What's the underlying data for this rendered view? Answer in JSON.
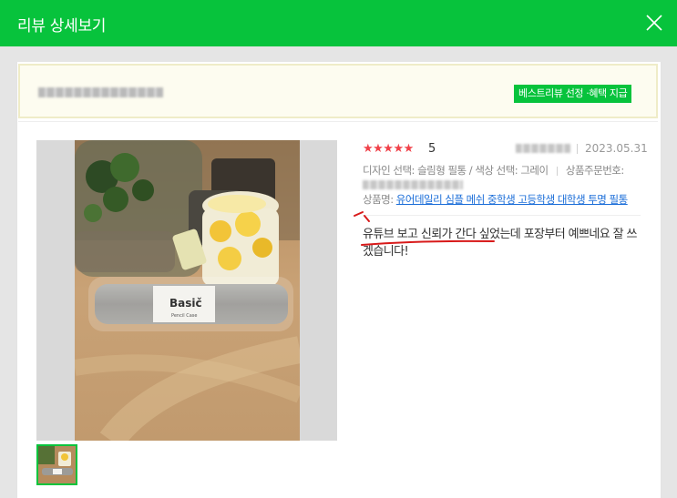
{
  "header": {
    "title": "리뷰 상세보기",
    "close_icon": "close-icon"
  },
  "banner": {
    "badge": "베스트리뷰 선정 ·혜택 지급"
  },
  "review": {
    "rating": 5,
    "stars": "★★★★★",
    "score_text": "5",
    "date": "2023.05.31",
    "options_line1": "디자인 선택: 슬림형 필통 / 색상 선택: 그레이",
    "order_label": "상품주문번호:",
    "product_label": "상품명:",
    "product_link": "유어데일리 심플 메쉬 중학생 고등학생 대학생 투명 필통",
    "body": "유튜브 보고 신뢰가 간다 싶었는데 포장부터 예쁘네요 잘 쓰겠습니다!"
  },
  "colors": {
    "brand": "#07c33c",
    "star": "#f0424a",
    "link": "#1a6dd8",
    "annotation": "#d81a1a"
  }
}
